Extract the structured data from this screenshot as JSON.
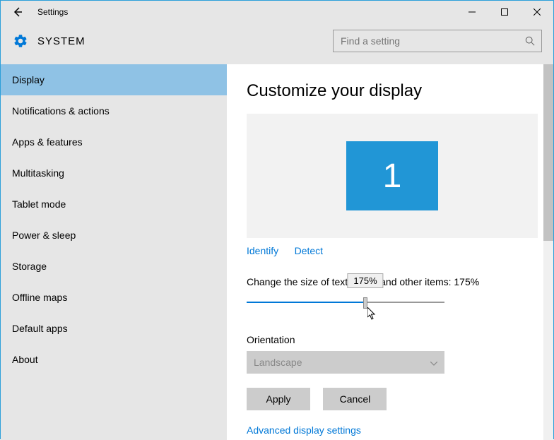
{
  "window": {
    "title": "Settings"
  },
  "header": {
    "system_label": "SYSTEM",
    "search_placeholder": "Find a setting"
  },
  "sidebar": {
    "items": [
      {
        "label": "Display",
        "selected": true
      },
      {
        "label": "Notifications & actions",
        "selected": false
      },
      {
        "label": "Apps & features",
        "selected": false
      },
      {
        "label": "Multitasking",
        "selected": false
      },
      {
        "label": "Tablet mode",
        "selected": false
      },
      {
        "label": "Power & sleep",
        "selected": false
      },
      {
        "label": "Storage",
        "selected": false
      },
      {
        "label": "Offline maps",
        "selected": false
      },
      {
        "label": "Default apps",
        "selected": false
      },
      {
        "label": "About",
        "selected": false
      }
    ]
  },
  "main": {
    "page_title": "Customize your display",
    "monitor_number": "1",
    "identify_label": "Identify",
    "detect_label": "Detect",
    "scale_label": "Change the size of text, apps, and other items: 175%",
    "scale_tooltip": "175%",
    "orientation_label": "Orientation",
    "orientation_value": "Landscape",
    "apply_label": "Apply",
    "cancel_label": "Cancel",
    "advanced_label": "Advanced display settings"
  }
}
